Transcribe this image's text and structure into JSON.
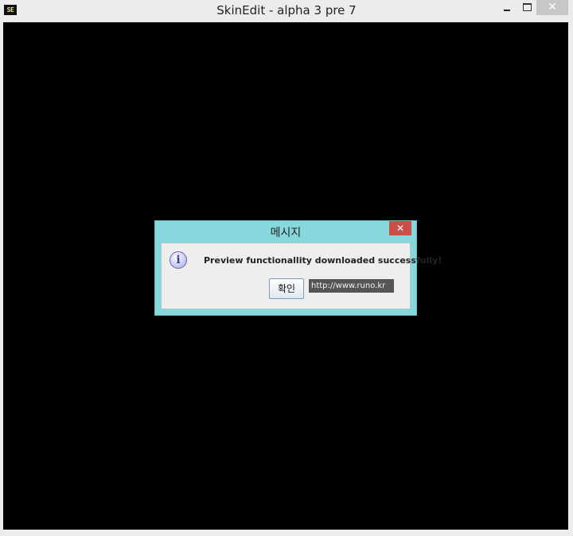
{
  "window": {
    "title": "SkinEdit - alpha 3 pre 7",
    "icon_text": "SE",
    "close_glyph": "✕"
  },
  "dialog": {
    "title": "메시지",
    "close_glyph": "✕",
    "icon_glyph": "i",
    "message": "Preview functionallity downloaded successfully!",
    "ok_label": "확인",
    "url": "http://www.runo.kr"
  }
}
